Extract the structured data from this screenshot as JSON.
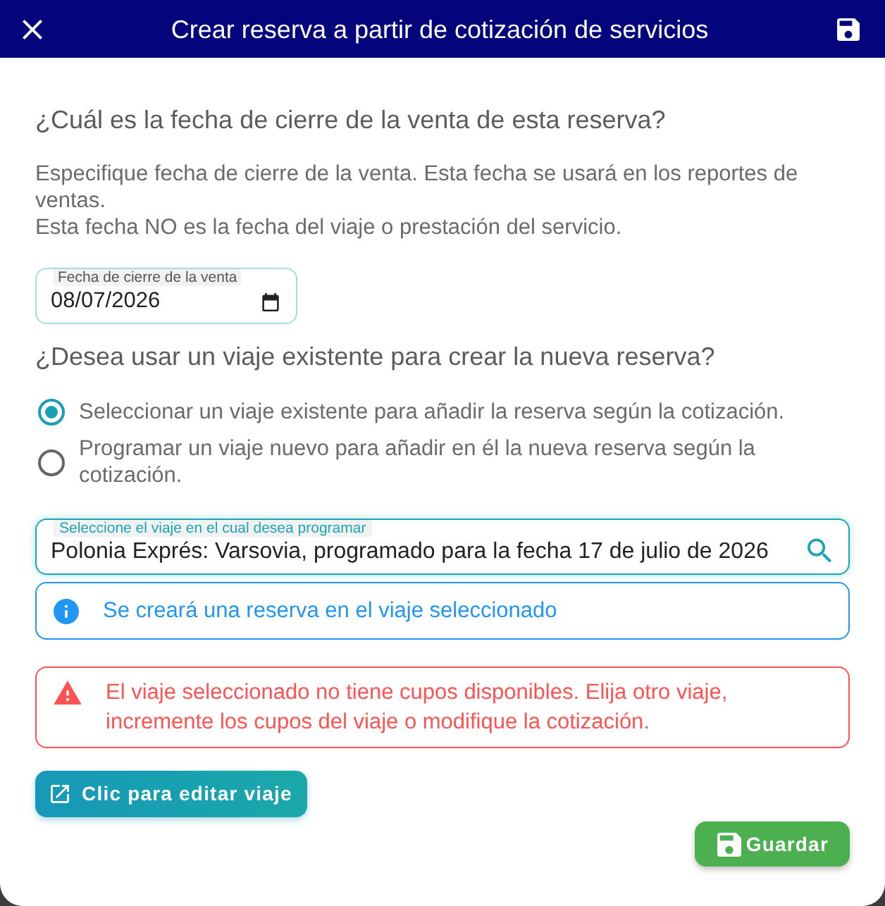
{
  "header": {
    "title": "Crear reserva a partir de cotización de servicios"
  },
  "closing_date": {
    "heading": "¿Cuál es la fecha de cierre de la venta de esta reserva?",
    "description": [
      "Especifique fecha de cierre de la venta. Esta fecha se usará en los reportes de ventas.",
      "Esta fecha NO es la fecha del viaje o prestación del servicio."
    ],
    "field": {
      "label": "Fecha de cierre de la venta",
      "value": "08/07/2026"
    }
  },
  "trip_choice": {
    "heading": "¿Desea usar un viaje existente para crear la nueva reserva?",
    "options": [
      {
        "label": "Seleccionar un viaje existente para añadir la reserva según la cotización.",
        "selected": true
      },
      {
        "label": "Programar un viaje nuevo para añadir en él la nueva reserva según la cotización.",
        "selected": false
      }
    ]
  },
  "trip_field": {
    "label": "Seleccione el viaje en el cual desea programar",
    "value": "Polonia Exprés: Varsovia, programado para la fecha 17 de julio de 2026"
  },
  "alerts": [
    {
      "kind": "info",
      "text": "Se creará una reserva en el viaje seleccionado"
    },
    {
      "kind": "error",
      "text": "El viaje seleccionado no tiene cupos disponibles. Elija otro viaje, incremente los cupos del viaje o modifique la cotización."
    }
  ],
  "buttons": [
    {
      "kind": "edit",
      "label": "Clic para editar viaje"
    },
    {
      "kind": "save",
      "label": "Guardar"
    }
  ]
}
